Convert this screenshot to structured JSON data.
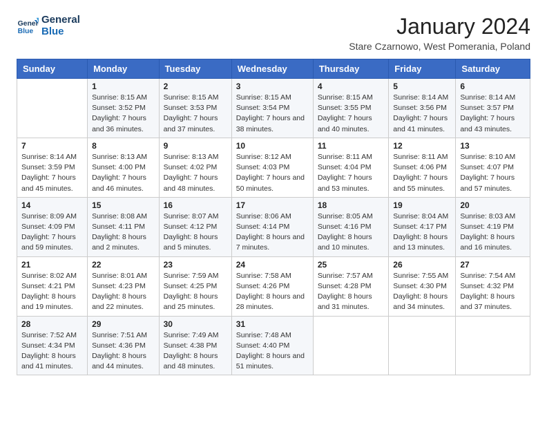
{
  "logo": {
    "line1": "General",
    "line2": "Blue"
  },
  "title": "January 2024",
  "location": "Stare Czarnowo, West Pomerania, Poland",
  "days_of_week": [
    "Sunday",
    "Monday",
    "Tuesday",
    "Wednesday",
    "Thursday",
    "Friday",
    "Saturday"
  ],
  "weeks": [
    [
      {
        "day": "",
        "sunrise": "",
        "sunset": "",
        "daylight": ""
      },
      {
        "day": "1",
        "sunrise": "Sunrise: 8:15 AM",
        "sunset": "Sunset: 3:52 PM",
        "daylight": "Daylight: 7 hours and 36 minutes."
      },
      {
        "day": "2",
        "sunrise": "Sunrise: 8:15 AM",
        "sunset": "Sunset: 3:53 PM",
        "daylight": "Daylight: 7 hours and 37 minutes."
      },
      {
        "day": "3",
        "sunrise": "Sunrise: 8:15 AM",
        "sunset": "Sunset: 3:54 PM",
        "daylight": "Daylight: 7 hours and 38 minutes."
      },
      {
        "day": "4",
        "sunrise": "Sunrise: 8:15 AM",
        "sunset": "Sunset: 3:55 PM",
        "daylight": "Daylight: 7 hours and 40 minutes."
      },
      {
        "day": "5",
        "sunrise": "Sunrise: 8:14 AM",
        "sunset": "Sunset: 3:56 PM",
        "daylight": "Daylight: 7 hours and 41 minutes."
      },
      {
        "day": "6",
        "sunrise": "Sunrise: 8:14 AM",
        "sunset": "Sunset: 3:57 PM",
        "daylight": "Daylight: 7 hours and 43 minutes."
      }
    ],
    [
      {
        "day": "7",
        "sunrise": "Sunrise: 8:14 AM",
        "sunset": "Sunset: 3:59 PM",
        "daylight": "Daylight: 7 hours and 45 minutes."
      },
      {
        "day": "8",
        "sunrise": "Sunrise: 8:13 AM",
        "sunset": "Sunset: 4:00 PM",
        "daylight": "Daylight: 7 hours and 46 minutes."
      },
      {
        "day": "9",
        "sunrise": "Sunrise: 8:13 AM",
        "sunset": "Sunset: 4:02 PM",
        "daylight": "Daylight: 7 hours and 48 minutes."
      },
      {
        "day": "10",
        "sunrise": "Sunrise: 8:12 AM",
        "sunset": "Sunset: 4:03 PM",
        "daylight": "Daylight: 7 hours and 50 minutes."
      },
      {
        "day": "11",
        "sunrise": "Sunrise: 8:11 AM",
        "sunset": "Sunset: 4:04 PM",
        "daylight": "Daylight: 7 hours and 53 minutes."
      },
      {
        "day": "12",
        "sunrise": "Sunrise: 8:11 AM",
        "sunset": "Sunset: 4:06 PM",
        "daylight": "Daylight: 7 hours and 55 minutes."
      },
      {
        "day": "13",
        "sunrise": "Sunrise: 8:10 AM",
        "sunset": "Sunset: 4:07 PM",
        "daylight": "Daylight: 7 hours and 57 minutes."
      }
    ],
    [
      {
        "day": "14",
        "sunrise": "Sunrise: 8:09 AM",
        "sunset": "Sunset: 4:09 PM",
        "daylight": "Daylight: 7 hours and 59 minutes."
      },
      {
        "day": "15",
        "sunrise": "Sunrise: 8:08 AM",
        "sunset": "Sunset: 4:11 PM",
        "daylight": "Daylight: 8 hours and 2 minutes."
      },
      {
        "day": "16",
        "sunrise": "Sunrise: 8:07 AM",
        "sunset": "Sunset: 4:12 PM",
        "daylight": "Daylight: 8 hours and 5 minutes."
      },
      {
        "day": "17",
        "sunrise": "Sunrise: 8:06 AM",
        "sunset": "Sunset: 4:14 PM",
        "daylight": "Daylight: 8 hours and 7 minutes."
      },
      {
        "day": "18",
        "sunrise": "Sunrise: 8:05 AM",
        "sunset": "Sunset: 4:16 PM",
        "daylight": "Daylight: 8 hours and 10 minutes."
      },
      {
        "day": "19",
        "sunrise": "Sunrise: 8:04 AM",
        "sunset": "Sunset: 4:17 PM",
        "daylight": "Daylight: 8 hours and 13 minutes."
      },
      {
        "day": "20",
        "sunrise": "Sunrise: 8:03 AM",
        "sunset": "Sunset: 4:19 PM",
        "daylight": "Daylight: 8 hours and 16 minutes."
      }
    ],
    [
      {
        "day": "21",
        "sunrise": "Sunrise: 8:02 AM",
        "sunset": "Sunset: 4:21 PM",
        "daylight": "Daylight: 8 hours and 19 minutes."
      },
      {
        "day": "22",
        "sunrise": "Sunrise: 8:01 AM",
        "sunset": "Sunset: 4:23 PM",
        "daylight": "Daylight: 8 hours and 22 minutes."
      },
      {
        "day": "23",
        "sunrise": "Sunrise: 7:59 AM",
        "sunset": "Sunset: 4:25 PM",
        "daylight": "Daylight: 8 hours and 25 minutes."
      },
      {
        "day": "24",
        "sunrise": "Sunrise: 7:58 AM",
        "sunset": "Sunset: 4:26 PM",
        "daylight": "Daylight: 8 hours and 28 minutes."
      },
      {
        "day": "25",
        "sunrise": "Sunrise: 7:57 AM",
        "sunset": "Sunset: 4:28 PM",
        "daylight": "Daylight: 8 hours and 31 minutes."
      },
      {
        "day": "26",
        "sunrise": "Sunrise: 7:55 AM",
        "sunset": "Sunset: 4:30 PM",
        "daylight": "Daylight: 8 hours and 34 minutes."
      },
      {
        "day": "27",
        "sunrise": "Sunrise: 7:54 AM",
        "sunset": "Sunset: 4:32 PM",
        "daylight": "Daylight: 8 hours and 37 minutes."
      }
    ],
    [
      {
        "day": "28",
        "sunrise": "Sunrise: 7:52 AM",
        "sunset": "Sunset: 4:34 PM",
        "daylight": "Daylight: 8 hours and 41 minutes."
      },
      {
        "day": "29",
        "sunrise": "Sunrise: 7:51 AM",
        "sunset": "Sunset: 4:36 PM",
        "daylight": "Daylight: 8 hours and 44 minutes."
      },
      {
        "day": "30",
        "sunrise": "Sunrise: 7:49 AM",
        "sunset": "Sunset: 4:38 PM",
        "daylight": "Daylight: 8 hours and 48 minutes."
      },
      {
        "day": "31",
        "sunrise": "Sunrise: 7:48 AM",
        "sunset": "Sunset: 4:40 PM",
        "daylight": "Daylight: 8 hours and 51 minutes."
      },
      {
        "day": "",
        "sunrise": "",
        "sunset": "",
        "daylight": ""
      },
      {
        "day": "",
        "sunrise": "",
        "sunset": "",
        "daylight": ""
      },
      {
        "day": "",
        "sunrise": "",
        "sunset": "",
        "daylight": ""
      }
    ]
  ]
}
